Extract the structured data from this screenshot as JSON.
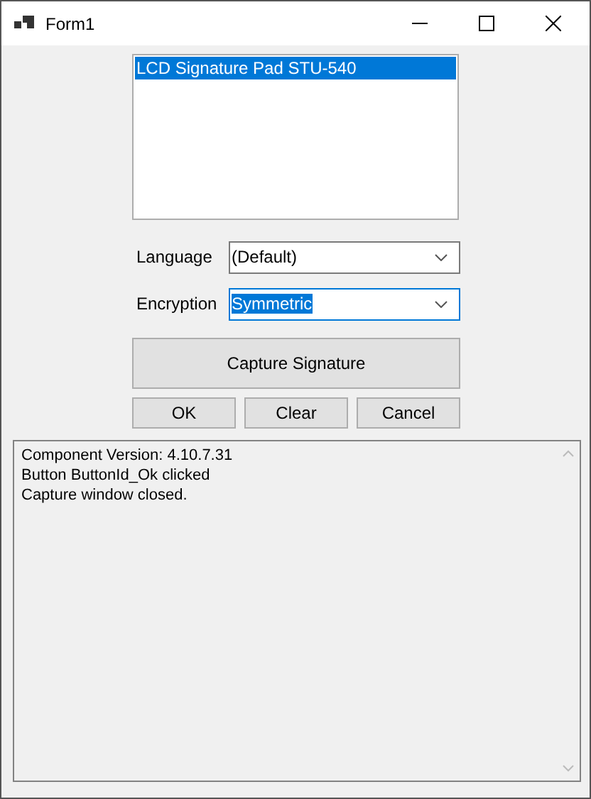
{
  "window": {
    "title": "Form1"
  },
  "device_list": {
    "items": [
      {
        "label": "LCD Signature Pad STU-540",
        "selected": true
      }
    ]
  },
  "fields": [
    {
      "label": "Language",
      "value": "(Default)",
      "focused": false
    },
    {
      "label": "Encryption",
      "value": "Symmetric",
      "focused": true
    }
  ],
  "capture_button": "Capture Signature",
  "buttons": [
    "OK",
    "Clear",
    "Cancel"
  ],
  "log": {
    "lines": [
      "Component Version: 4.10.7.31",
      "Button ButtonId_Ok clicked",
      "Capture window closed."
    ]
  }
}
